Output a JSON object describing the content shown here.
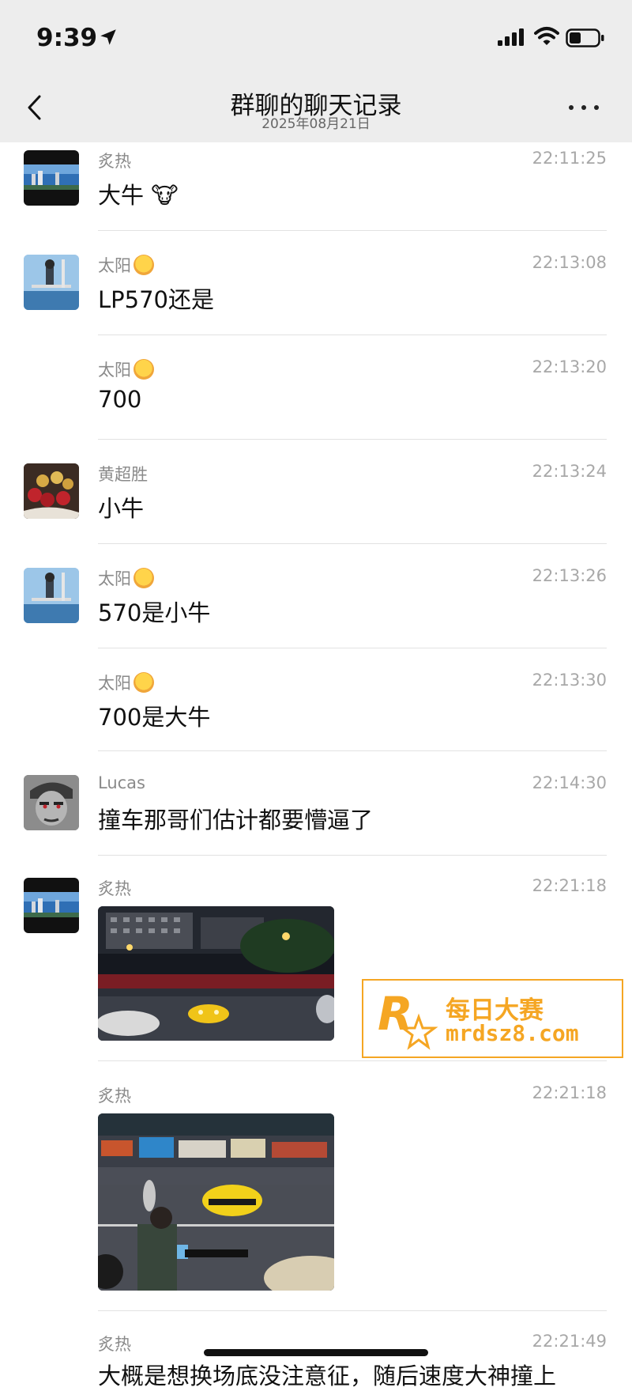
{
  "status_bar": {
    "time": "9:39"
  },
  "header": {
    "title": "群聊的聊天记录",
    "date": "2025年08月21日"
  },
  "messages": [
    {
      "sender": "炙热",
      "time": "22:11:25",
      "text": "大牛 🐮"
    },
    {
      "sender": "太阳",
      "time": "22:13:08",
      "text": "LP570还是"
    },
    {
      "sender": "太阳",
      "time": "22:13:20",
      "text": "700"
    },
    {
      "sender": "黄超胜",
      "time": "22:13:24",
      "text": "小牛"
    },
    {
      "sender": "太阳",
      "time": "22:13:26",
      "text": "570是小牛"
    },
    {
      "sender": "太阳",
      "time": "22:13:30",
      "text": "700是大牛"
    },
    {
      "sender": "Lucas",
      "time": "22:14:30",
      "text": "撞车那哥们估计都要懵逼了"
    },
    {
      "sender": "炙热",
      "time": "22:21:18"
    },
    {
      "sender": "炙热",
      "time": "22:21:18"
    },
    {
      "sender": "炙热",
      "time": "22:21:49",
      "text": "大概是想换场底没注意征，随后速度大神撞上"
    }
  ],
  "watermark": {
    "brand": "每日大赛",
    "url": "mrdsz8.com",
    "logo_text": "R"
  },
  "colors": {
    "background": "#ffffff",
    "header": "#ededed",
    "meta": "#a8a8a8",
    "watermark": "#f5a623"
  }
}
